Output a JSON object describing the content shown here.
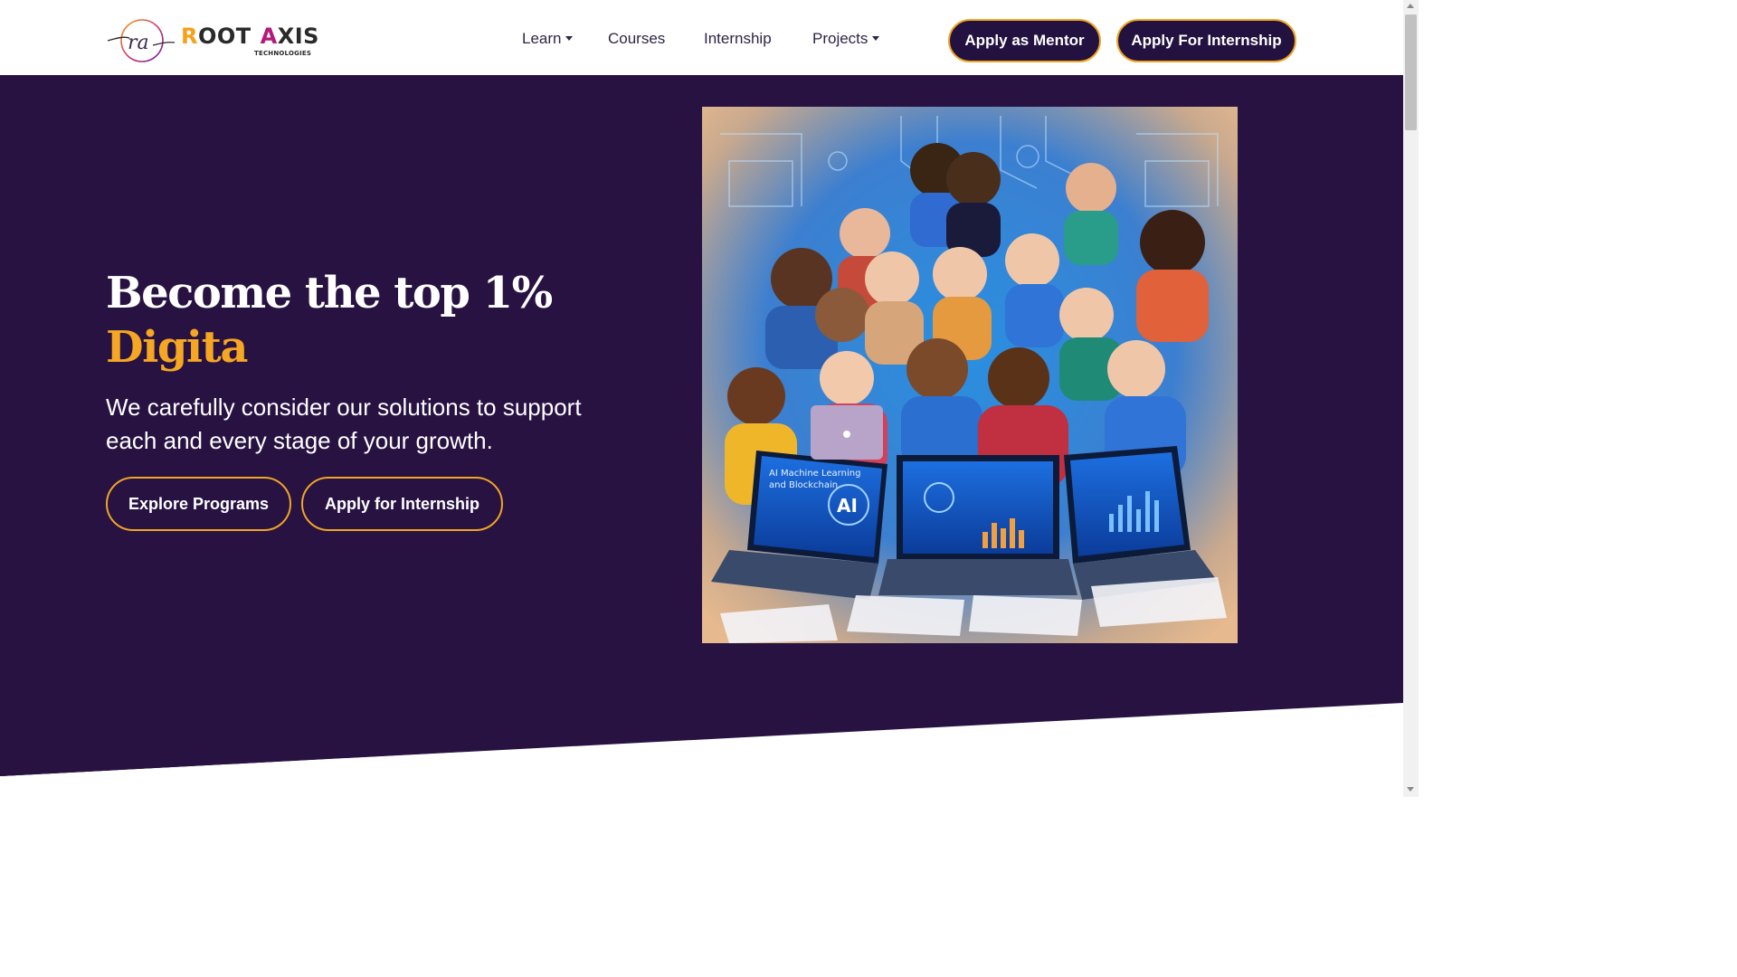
{
  "brand": {
    "logo_mark": "ra",
    "name_part1_initial": "R",
    "name_part1_rest": "OOT",
    "name_part2_initial": "A",
    "name_part2_rest": "XIS",
    "subtitle": "TECHNOLOGIES"
  },
  "nav": {
    "items": [
      {
        "label": "Learn",
        "has_dropdown": true
      },
      {
        "label": "Courses",
        "has_dropdown": false
      },
      {
        "label": "Internship",
        "has_dropdown": false
      },
      {
        "label": "Projects",
        "has_dropdown": true
      }
    ],
    "cta_mentor": "Apply as Mentor",
    "cta_internship": "Apply For Internship"
  },
  "hero": {
    "headline_line1": "Become the top 1%",
    "headline_line2": "Digita",
    "subtext": "We carefully consider our solutions to support each and every stage of your growth.",
    "btn_explore": "Explore Programs",
    "btn_apply": "Apply for Internship",
    "image_laptop_text": "AI Machine Learning and Blockchain",
    "image_ai_badge": "AI"
  },
  "colors": {
    "hero_bg": "#271242",
    "accent": "#f5a623",
    "button_dark": "#23123f",
    "brand_r": "#f5a11c",
    "brand_a": "#b5197a"
  }
}
